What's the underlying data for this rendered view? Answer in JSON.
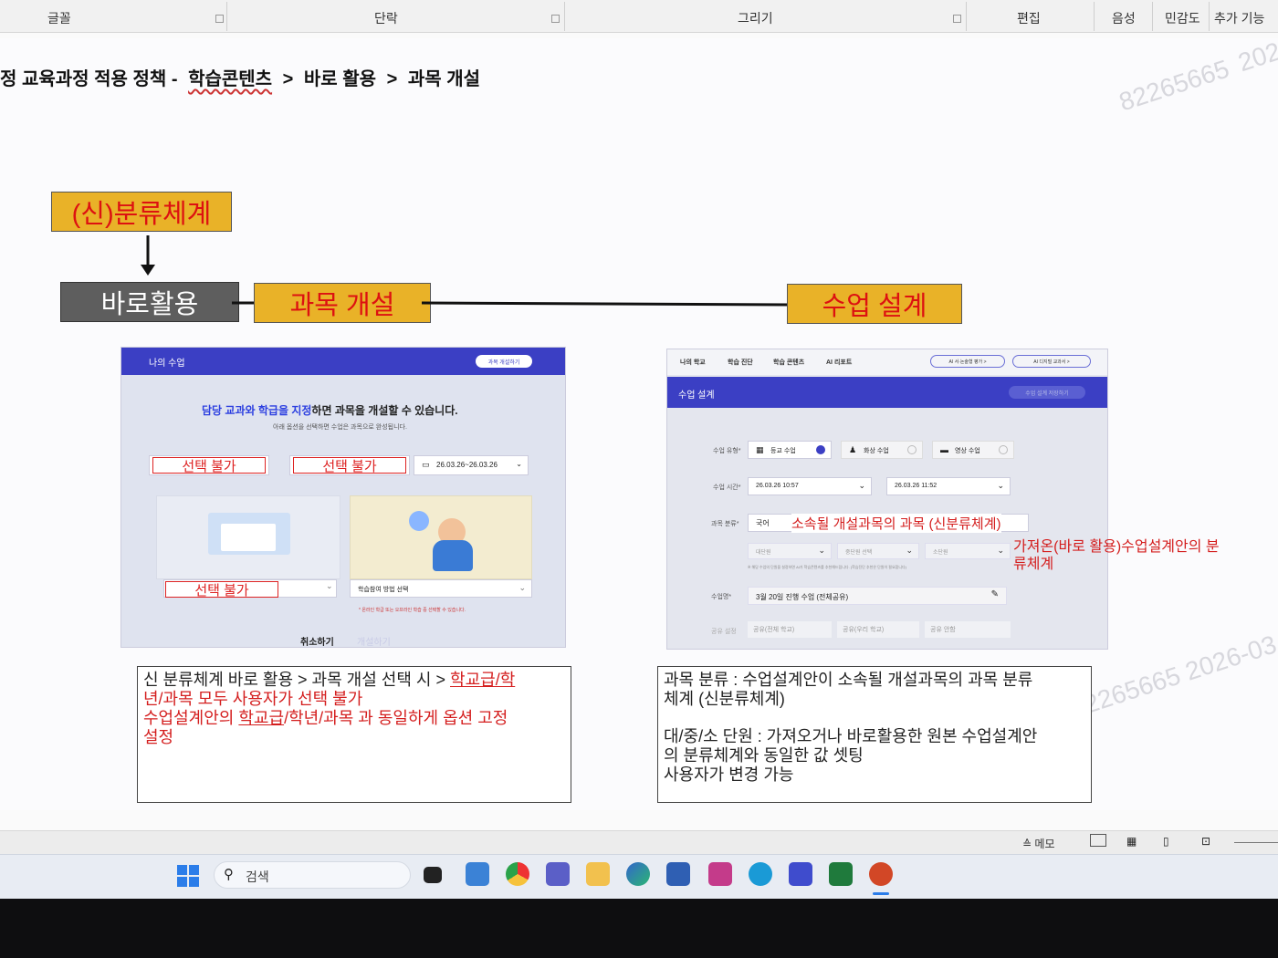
{
  "ribbon": {
    "groups": [
      "글꼴",
      "단락",
      "그리기",
      "편집",
      "음성",
      "민감도",
      "추가 기능"
    ]
  },
  "breadcrumb": {
    "prefix": "정 교육과정 적용 정책 -",
    "part1": "학습콘텐츠",
    "sep": ">",
    "part2": "바로 활용",
    "part3": "과목 개설"
  },
  "watermark": {
    "text1": "82265665",
    "text2": "2026-03",
    "text3": "82265665 2026-03"
  },
  "flow": {
    "new_category": "(신)분류체계",
    "direct_use": "바로활용",
    "course_open": "과목 개설",
    "class_design": "수업 설계"
  },
  "left_shot": {
    "header_title": "나의 수업",
    "header_button": "과목 개설하기",
    "headline_blue": "담당 교과와 학급을 지정",
    "headline_rest": "하면 과목을 개설할 수 있습니다.",
    "subline": "아래 옵션을 선택하면 수업은 과목으로 완성됩니다.",
    "select_blocked_1": "선택 불가",
    "select_blocked_2": "선택 불가",
    "select_blocked_3": "선택 불가",
    "date_range": "26.03.26~26.03.26",
    "method_label": "학습참여 방법 선택",
    "note": "* 온라인 학급 또는 오프라인 학습 중 선택할 수 있습니다.",
    "cancel": "취소하기",
    "confirm": "개설하기"
  },
  "right_shot": {
    "nav": [
      "나의 학교",
      "학습 진단",
      "학습 콘텐츠",
      "AI 리포트"
    ],
    "nav_btn1": "AI 서·논술형 평가 >",
    "nav_btn2": "AI 디지털 교과서 >",
    "header_title": "수업 설계",
    "header_button": "수업 설계 저장하기",
    "type_label": "수업 유형*",
    "type_opt1": "등교 수업",
    "type_opt2": "화상 수업",
    "type_opt3": "영상 수업",
    "time_label": "수업 시간*",
    "time_start": "26.03.26 10:57",
    "time_end": "26.03.26 11:52",
    "subject_label": "과목 분류*",
    "subject_value": "국어",
    "subject_annotation": "소속될 개설과목의 과목 (신분류체계)",
    "unit_sel1": "대단원",
    "unit_sel2": "중단원 선택",
    "unit_sel3": "소단원",
    "unit_note": "※ 해당 수업의 단원을 설정하면 AI가 학습콘텐츠를 추천해드립니다. (학습진단 추천은 단원이 필요합니다)",
    "side_annotation": "가져온(바로 활용)수업설계안의 분류체계",
    "class_label": "수업명*",
    "class_value": "3월 20일 진행 수업 (전체공유)",
    "share_label": "공유 설정",
    "share_opt1": "공유(전체 학교)",
    "share_opt2": "공유(우리 학교)",
    "share_opt3": "공유 안함"
  },
  "left_note": {
    "line1_a": "신 분류체계 바로 활용 > 과목 개설 선택 시 >",
    "line1_b": "학교급/학",
    "line2": "년/과목 모두 사용자가 선택 불가",
    "line3_a": "수업설계안의",
    "line3_b": "학교급",
    "line3_c": "/학년/과목 과 동일하게 옵션 고정",
    "line4": "설정"
  },
  "right_note": {
    "line1": "과목 분류 : 수업설계안이 소속될 개설과목의 과목 분류",
    "line2": "체계 (신분류체계)",
    "line3": "대/중/소 단원 : 가져오거나 바로활용한 원본 수업설계안",
    "line4": "의 분류체계와 동일한 값 셋팅",
    "line5": "사용자가 변경 가능"
  },
  "statusbar": {
    "memo": "메모"
  },
  "taskbar": {
    "search_placeholder": "검색"
  },
  "colors": {
    "accent_yellow": "#e9b228",
    "accent_red": "#d41e1e",
    "header_blue": "#3b3fc4"
  }
}
